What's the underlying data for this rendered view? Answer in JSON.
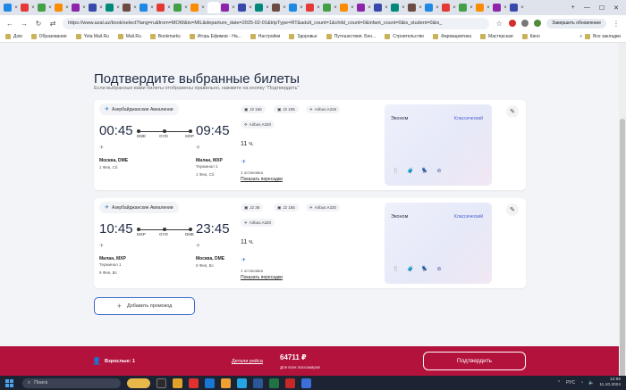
{
  "browser": {
    "url": "https://www.azal.az/book/select?lang=ru&from=MOW&to=MIL&departure_date=2025-02-01&tripType=RT&adult_count=1&child_count=0&infant_count=0&is_student=0&is_",
    "update_button": "Завершить обновление",
    "bookmarks": [
      "Дом",
      "Образование",
      "Yota Mail.Ru",
      "Mail.Ru",
      "Bookmarks",
      "Игорь Ефимов - На...",
      "Настройки",
      "Здоровье",
      "Путешествия. Бен...",
      "Строительство",
      "Фармацевтика",
      "Мастерская",
      "Кино"
    ],
    "all_bookmarks": "Все закладки",
    "tab_close": "×",
    "tab_add": "+",
    "bookmarks_more": "»"
  },
  "page": {
    "title": "Подтвердите выбранные билеты",
    "subtitle": "Если выбранные вами билеты отображены правильно, нажмите на кнопку \"Подтвердить\""
  },
  "flights": [
    {
      "airline": "Азербайджанские Авиалинии",
      "dep_time": "00:45",
      "arr_time": "09:45",
      "codes": [
        "DME",
        "GYD",
        "MXP"
      ],
      "dep_city": "Москва, DME",
      "dep_terminal": "",
      "dep_date": "1 Фев, Сб",
      "arr_city": "Милан, MXP",
      "arr_terminal": "Терминал 1",
      "arr_date": "1 Фев, Сб",
      "chips": [
        "J2 166",
        "J2 105",
        "Airbus A319",
        "Airbus A320"
      ],
      "duration": "11 ч.",
      "stops": "1 остановка",
      "transfer_link": "Показать пересадки",
      "tariff": "Эконом",
      "tariff_class": "Классический"
    },
    {
      "airline": "Азербайджанские Авиалинии",
      "dep_time": "10:45",
      "arr_time": "23:45",
      "codes": [
        "MXP",
        "GYD",
        "DME"
      ],
      "dep_city": "Милан, MXP",
      "dep_terminal": "Терминал 1",
      "dep_date": "9 Фев, Вс",
      "arr_city": "Москва, DME",
      "arr_terminal": "",
      "arr_date": "9 Фев, Вс",
      "chips": [
        "J2 36",
        "J2 165",
        "Airbus A320",
        "Airbus A320"
      ],
      "duration": "11 ч.",
      "stops": "1 остановка",
      "transfer_link": "Показать пересадки",
      "tariff": "Эконом",
      "tariff_class": "Классический"
    }
  ],
  "promo_button": "Добавить промокод",
  "bottom": {
    "passengers": "Взрослые: 1",
    "trip_details": "Детали рейса",
    "price": "64711 ₽",
    "price_sub": "Для всех пассажиров",
    "confirm": "Подтвердить"
  },
  "taskbar": {
    "search": "Поиск",
    "lang": "РУС",
    "time": "12:56",
    "date": "11.10.2024"
  },
  "colors": {
    "brand": "#b3123d",
    "accent": "#3a68c7"
  }
}
